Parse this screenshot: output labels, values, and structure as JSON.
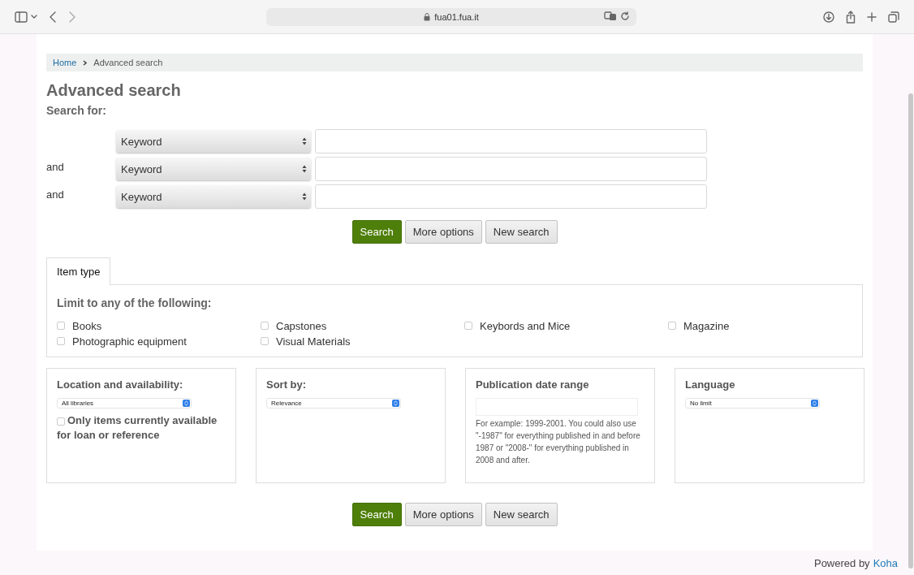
{
  "browser": {
    "url": "fua01.fua.it"
  },
  "breadcrumb": [
    {
      "label": "Home",
      "kind": "link"
    },
    {
      "label": "Advanced search",
      "kind": "current"
    }
  ],
  "title": "Advanced search",
  "search_for_label": "Search for:",
  "search_rows": [
    {
      "field": "Keyword"
    },
    {
      "operator": "and",
      "field": "Keyword"
    },
    {
      "operator": "and",
      "field": "Keyword"
    }
  ],
  "buttons_top": [
    {
      "label": "Search",
      "kind": "primary"
    },
    {
      "label": "More options",
      "kind": "secondary"
    },
    {
      "label": "New search",
      "kind": "secondary"
    }
  ],
  "tabs": [
    {
      "label": "Item type",
      "selected": true
    }
  ],
  "item_type": {
    "heading": "Limit to any of the following:",
    "options": [
      {
        "label": "Books",
        "checked": false
      },
      {
        "label": "Capstones",
        "checked": false
      },
      {
        "label": "Keybords and Mice",
        "checked": false
      },
      {
        "label": "Magazine",
        "checked": false
      },
      {
        "label": "Photographic equipment",
        "checked": false
      },
      {
        "label": "Visual Materials",
        "checked": false
      }
    ]
  },
  "location": {
    "heading": "Location and availability:",
    "library": "All libraries",
    "available_only": {
      "label": "Only items currently available for loan or reference",
      "checked": false
    }
  },
  "sort": {
    "heading": "Sort by:",
    "value": "Relevance"
  },
  "date_range": {
    "heading": "Publication date range",
    "hint": "For example: 1999-2001. You could also use \"-1987\" for everything published in and before 1987 or \"2008-\" for everything published in 2008 and after."
  },
  "language": {
    "heading": "Language",
    "value": "No limit"
  },
  "buttons_bottom": [
    {
      "label": "Search",
      "kind": "primary"
    },
    {
      "label": "More options",
      "kind": "secondary"
    },
    {
      "label": "New search",
      "kind": "secondary"
    }
  ],
  "footer": {
    "text": "Powered by",
    "link": "Koha"
  }
}
